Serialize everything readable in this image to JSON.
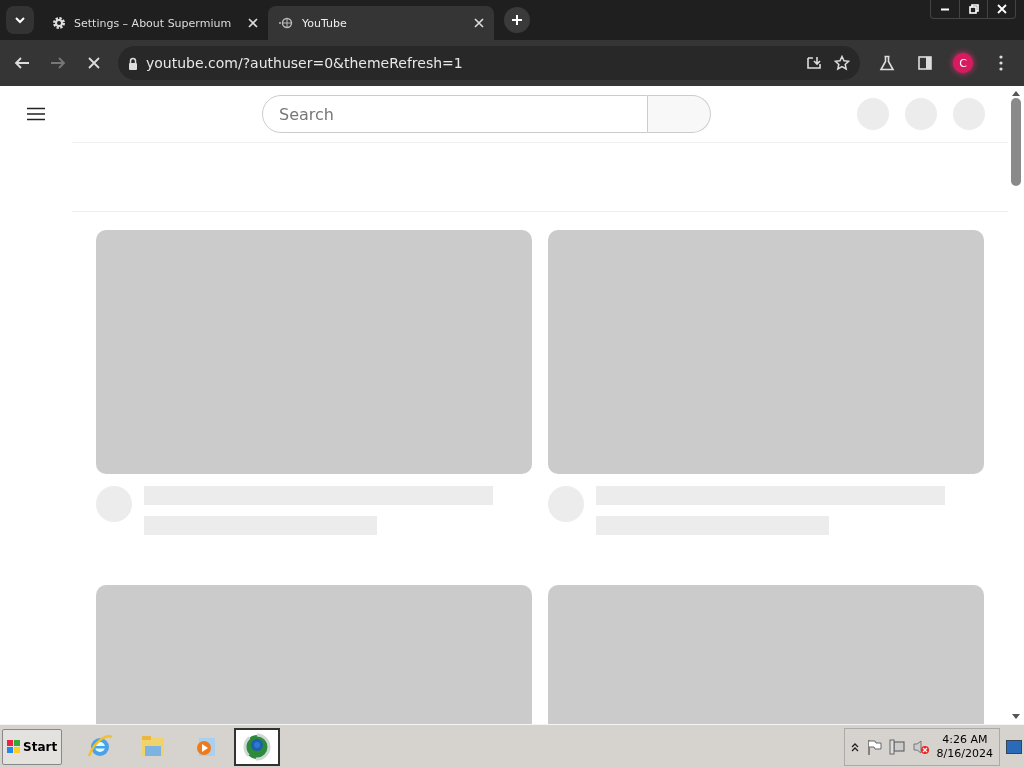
{
  "browser": {
    "tabs": [
      {
        "title": "Settings – About Supermium",
        "kind": "settings",
        "selected": false
      },
      {
        "title": "YouTube",
        "kind": "loading",
        "selected": true
      }
    ],
    "toolbar": {
      "loading": true,
      "url": "youtube.com/?authuser=0&themeRefresh=1",
      "profile": "C"
    }
  },
  "page": {
    "search": {
      "placeholder": "Search"
    },
    "feed": {
      "loading": true
    }
  },
  "taskbar": {
    "start": "Start",
    "apps": [
      {
        "kind": "ie",
        "selected": false
      },
      {
        "kind": "explorer",
        "selected": false
      },
      {
        "kind": "media",
        "selected": false
      },
      {
        "kind": "browser",
        "selected": true
      }
    ],
    "time": "4:26 AM",
    "date": "8/16/2024"
  }
}
